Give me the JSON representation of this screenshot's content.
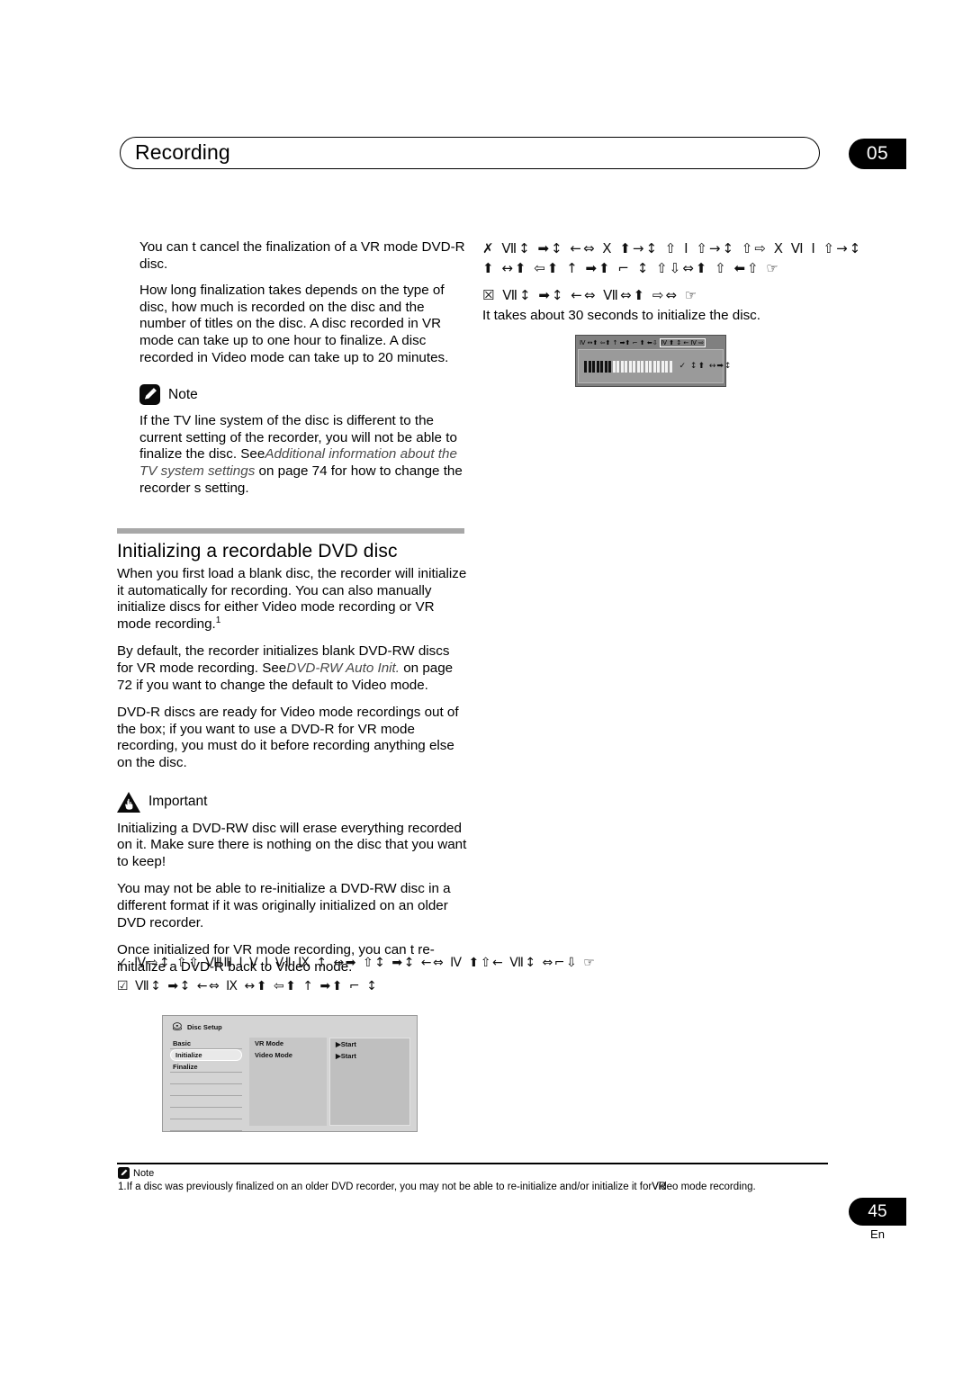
{
  "header": {
    "title": "Recording",
    "chapter_number": "05"
  },
  "left_column": {
    "paragraphs": [
      "You can t cancel the finalization of a VR mode DVD-R disc.",
      "How long finalization takes depends on the type of disc, how much is recorded on the disc and the number of titles on the disc. A disc recorded in VR mode can take up to one hour to finalize. A disc recorded in Video mode can take up to 20 minutes."
    ],
    "note": {
      "label": "Note",
      "icon": "pencil-note-icon",
      "text_before_italic": "If the TV line system of the disc is different to the current setting of the recorder, you will not be able to finalize the disc. See",
      "italic_text": "Additional information about the TV system settings",
      "text_after_italic": " on page 74 for how to change the recorder s setting."
    }
  },
  "right_column": {
    "symbol_line_1": "✗  Ⅶ↕  ➡↕  ←⇔   Ⅹ ⬆→↕  ⇧ Ⅰ  ⇧→↕       ⇧⇨    Ⅹ Ⅵ Ⅰ  ⇧→↕",
    "symbol_line_2": "⬆ ↔⬆ ⇦⬆ ↑  ➡⬆ ⌐ ↕   ⇧⇩⇔⬆ ⇧ ⬅⇧ ☞",
    "symbol_line_3": "☒  Ⅶ↕  ➡↕  ←⇔   Ⅶ⇔⬆ ⇨⇔  ☞",
    "caption": "It takes about 30 seconds to initialize the disc.",
    "display_figure": {
      "top_bar": "Ⅳ ↔⬆ ⇦⬆ ↑ ➡⬆ ⌐ ⬆ ⬅⇩",
      "top_bar_boxed": "Ⅳ ⬆ ↕ ← Ⅳ ⇨",
      "progress_dark_segments": 7,
      "progress_light_segments": 15,
      "screen_right_symbols": "✓ ↕⬆ ↔➡↕"
    }
  },
  "section": {
    "title": "Initializing a recordable DVD disc",
    "paragraphs": [
      "When you first load a blank disc, the recorder will initialize it automatically for recording. You can also manually initialize discs for either Video mode recording or VR mode recording.",
      "By default, the recorder initializes blank DVD-RW discs for VR mode recording. See",
      "DVD-R discs are ready for Video mode recordings out of the box; if you want to use a DVD-R for VR mode recording, you must do it before recording anything else on the disc."
    ],
    "paragraph_2_italic": "DVD-RW Auto Init.",
    "paragraph_2_after": " on page 72 if you want to change the default to Video mode.",
    "footnote_marker": "1",
    "important": {
      "label": "Important",
      "icon": "warning-hand-icon",
      "paragraphs": [
        "Initializing a DVD-RW disc will erase everything recorded on it. Make sure there is nothing on the disc that you want to keep!",
        "You may not be able to re-initialize a DVD-RW disc in a different format if it was originally initialized on an older DVD recorder.",
        "Once initialized for VR mode recording, you can t re-initialize a DVD-R back to Video mode."
      ]
    },
    "symbol_line_1": "✓  Ⅳ⇨↕  ⇧⇧ ⅧⅢ Ⅰ Ⅴ Ⅰ  ⅤⅡ Ⅸ ↑  ↔➡ ⇧↕  ➡↕  ←⇔   Ⅳ ⬆⇧← Ⅶ↕  ⇔⌐⇩   ☞",
    "symbol_line_2": "☑  Ⅶ↕  ➡↕  ←⇔    Ⅸ ↔⬆ ⇦⬆ ↑  ➡⬆ ⌐ ↕"
  },
  "osd_screenshot": {
    "title": "Disc Setup",
    "title_icon": "disc-icon",
    "left_menu": [
      {
        "label": "Basic",
        "selected": false
      },
      {
        "label": "Initialize",
        "selected": true
      },
      {
        "label": "Finalize",
        "selected": false
      }
    ],
    "options": [
      {
        "label": "VR Mode",
        "action": "Start"
      },
      {
        "label": "Video Mode",
        "action": "Start"
      }
    ],
    "action_arrow": "▶"
  },
  "footnote": {
    "label": "Note",
    "icon": "pencil-note-icon",
    "number": "1.",
    "text": "If a disc was previously finalized on an older DVD recorder, you may not be able to re-initialize and/or initialize it for",
    "overlap_a": "VR",
    "overlap_b": "Video",
    "text_end": " mode recording."
  },
  "footer": {
    "page_number": "45",
    "language": "En"
  }
}
